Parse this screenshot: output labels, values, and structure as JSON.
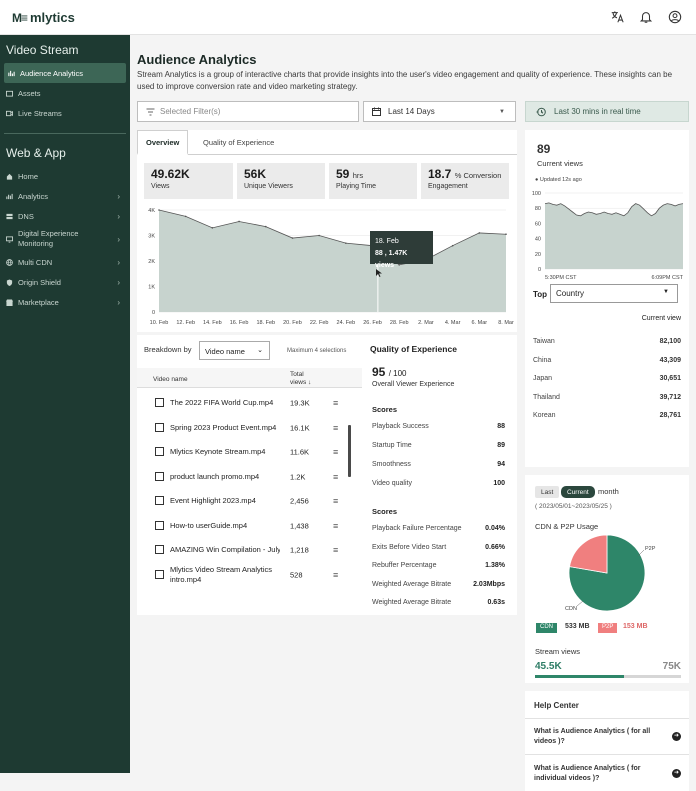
{
  "app": {
    "brand": "mlytics",
    "brand_mark": "M≡"
  },
  "topbar": {
    "icons": [
      "translate-icon",
      "bell-icon",
      "account-icon"
    ]
  },
  "sidebar": {
    "section1": "Video Stream",
    "items1": [
      {
        "label": "Audience Analytics",
        "icon": "chart-icon",
        "active": true
      },
      {
        "label": "Assets",
        "icon": "folder-icon"
      },
      {
        "label": "Live Streams",
        "icon": "live-icon"
      }
    ],
    "section2": "Web & App",
    "items2": [
      {
        "label": "Home",
        "icon": "home-icon"
      },
      {
        "label": "Analytics",
        "icon": "bar-chart-icon",
        "chevron": true
      },
      {
        "label": "DNS",
        "icon": "dns-icon",
        "chevron": true
      },
      {
        "label": "Digital Experience Monitoring",
        "icon": "monitor-icon",
        "chevron": true
      },
      {
        "label": "Multi CDN",
        "icon": "globe-icon",
        "chevron": true
      },
      {
        "label": "Origin Shield",
        "icon": "shield-icon",
        "chevron": true
      },
      {
        "label": "Marketplace",
        "icon": "store-icon",
        "chevron": true
      }
    ]
  },
  "page": {
    "title": "Audience Analytics",
    "description": "Stream Analytics is a group of interactive charts that provide insights into the user's video engagement and quality of experience. These insights can be used to improve conversion rate and video marketing strategy."
  },
  "filters": {
    "filter_placeholder": "Selected Filter(s)",
    "date_range": "Last 14 Days",
    "realtime": "Last 30 mins in real time"
  },
  "tabs": [
    "Overview",
    "Quality of Experience"
  ],
  "kpis": [
    {
      "value": "49.62K",
      "unit": "",
      "label": "Views"
    },
    {
      "value": "56K",
      "unit": "",
      "label": "Unique Viewers"
    },
    {
      "value": "59",
      "unit": "hrs",
      "label": "Playing Time"
    },
    {
      "value": "18.7",
      "unit": "% Conversion",
      "label": "Engagement"
    }
  ],
  "chart_data": {
    "type": "area",
    "x": [
      "10. Feb",
      "12. Feb",
      "14. Feb",
      "16. Feb",
      "18. Feb",
      "20. Feb",
      "22. Feb",
      "24. Feb",
      "26. Feb",
      "28. Feb",
      "2. Mar",
      "4. Mar",
      "6. Mar",
      "8. Mar"
    ],
    "y_ticks": [
      "0",
      "1K",
      "2K",
      "3K",
      "4K"
    ],
    "ylim": [
      0,
      4000
    ],
    "series": [
      {
        "name": "Views",
        "points": [
          [
            0,
            4000
          ],
          [
            1,
            3750
          ],
          [
            2,
            3300
          ],
          [
            3,
            3550
          ],
          [
            4,
            3350
          ],
          [
            5,
            2900
          ],
          [
            6,
            3000
          ],
          [
            7,
            2700
          ],
          [
            8,
            2600
          ],
          [
            9,
            1850
          ],
          [
            10,
            2050
          ],
          [
            11,
            2600
          ],
          [
            12,
            3100
          ],
          [
            13,
            3050
          ]
        ]
      }
    ],
    "tooltip": {
      "date": "18. Feb",
      "value": "88 , 1.47K views"
    },
    "color": "#c7d3ce"
  },
  "breakdown": {
    "label": "Breakdown by",
    "select": "Video name",
    "max": "Maximum 4 selections",
    "col1": "Video name",
    "col2": "Total views ↓",
    "rows": [
      {
        "name": "The 2022 FIFA World Cup.mp4",
        "views": "19.3K"
      },
      {
        "name": "Spring 2023 Product Event.mp4",
        "views": "16.1K"
      },
      {
        "name": "Mlytics Keynote Stream.mp4",
        "views": "11.6K"
      },
      {
        "name": "product launch promo.mp4",
        "views": "1.2K"
      },
      {
        "name": "Event Highlight 2023.mp4",
        "views": "2,456"
      },
      {
        "name": "How-to userGuide.mp4",
        "views": "1,438"
      },
      {
        "name": "AMAZING Win Compilation - July 2",
        "views": "1,218"
      },
      {
        "name": "Mlytics Video Stream Analytics intro.mp4",
        "views": "528"
      }
    ]
  },
  "qoe": {
    "title": "Quality of Experience",
    "score": "95",
    "score_max": "/ 100",
    "score_label": "Overall Viewer Experience",
    "section1": "Scores",
    "scores": [
      {
        "label": "Playback Success",
        "value": "88"
      },
      {
        "label": "Startup Time",
        "value": "89"
      },
      {
        "label": "Smoothness",
        "value": "94"
      },
      {
        "label": "Video quality",
        "value": "100"
      }
    ],
    "section2": "Scores",
    "metrics": [
      {
        "label": "Playback Failure Percentage",
        "value": "0.04%"
      },
      {
        "label": "Exits Before Video Start",
        "value": "0.66%"
      },
      {
        "label": "Rebuffer Percentage",
        "value": "1.38%"
      },
      {
        "label": "Weighted Average Bitrate",
        "value": "2.03Mbps"
      },
      {
        "label": "Weighted Average Bitrate",
        "value": "0.63s"
      }
    ]
  },
  "realtime_panel": {
    "value": "89",
    "label": "Current views",
    "updated": "Updated 12s ago",
    "y_ticks": [
      "0",
      "20",
      "40",
      "60",
      "80",
      "100"
    ],
    "x_start": "5:30PM CST",
    "x_end": "6:09PM CST",
    "top_label": "Top",
    "select": "Country",
    "col": "Current view",
    "countries": [
      {
        "name": "Taiwan",
        "value": "82,100"
      },
      {
        "name": "China",
        "value": "43,309"
      },
      {
        "name": "Japan",
        "value": "30,651"
      },
      {
        "name": "Thailand",
        "value": "39,712"
      },
      {
        "name": "Korean",
        "value": "28,761"
      }
    ],
    "series": [
      86,
      87,
      85,
      84,
      86,
      83,
      79,
      75,
      71,
      70,
      73,
      75,
      74,
      72,
      73,
      75,
      73,
      72,
      74,
      72,
      70,
      74,
      82,
      86,
      84,
      79,
      74,
      70,
      73,
      80,
      84,
      86,
      85,
      83,
      85,
      86
    ]
  },
  "cdn_panel": {
    "last": "Last",
    "current": "Current",
    "month": "month",
    "range": "( 2023/05/01~2023/05/25 )",
    "title": "CDN & P2P Usage",
    "cdn_label": "CDN",
    "cdn_value": "533 MB",
    "p2p_label": "P2P",
    "p2p_value": "153 MB",
    "pie": [
      {
        "name": "CDN",
        "value": 533
      },
      {
        "name": "P2P",
        "value": 153
      }
    ],
    "stream_label": "Stream views",
    "stream_value": "45.5K",
    "stream_max": "75K",
    "stream_progress": 0.607
  },
  "help": {
    "title": "Help Center",
    "q1": "What is Audience Analytics ( for all videos )?",
    "q2": "What is Audience Analytics ( for individual videos )?"
  }
}
